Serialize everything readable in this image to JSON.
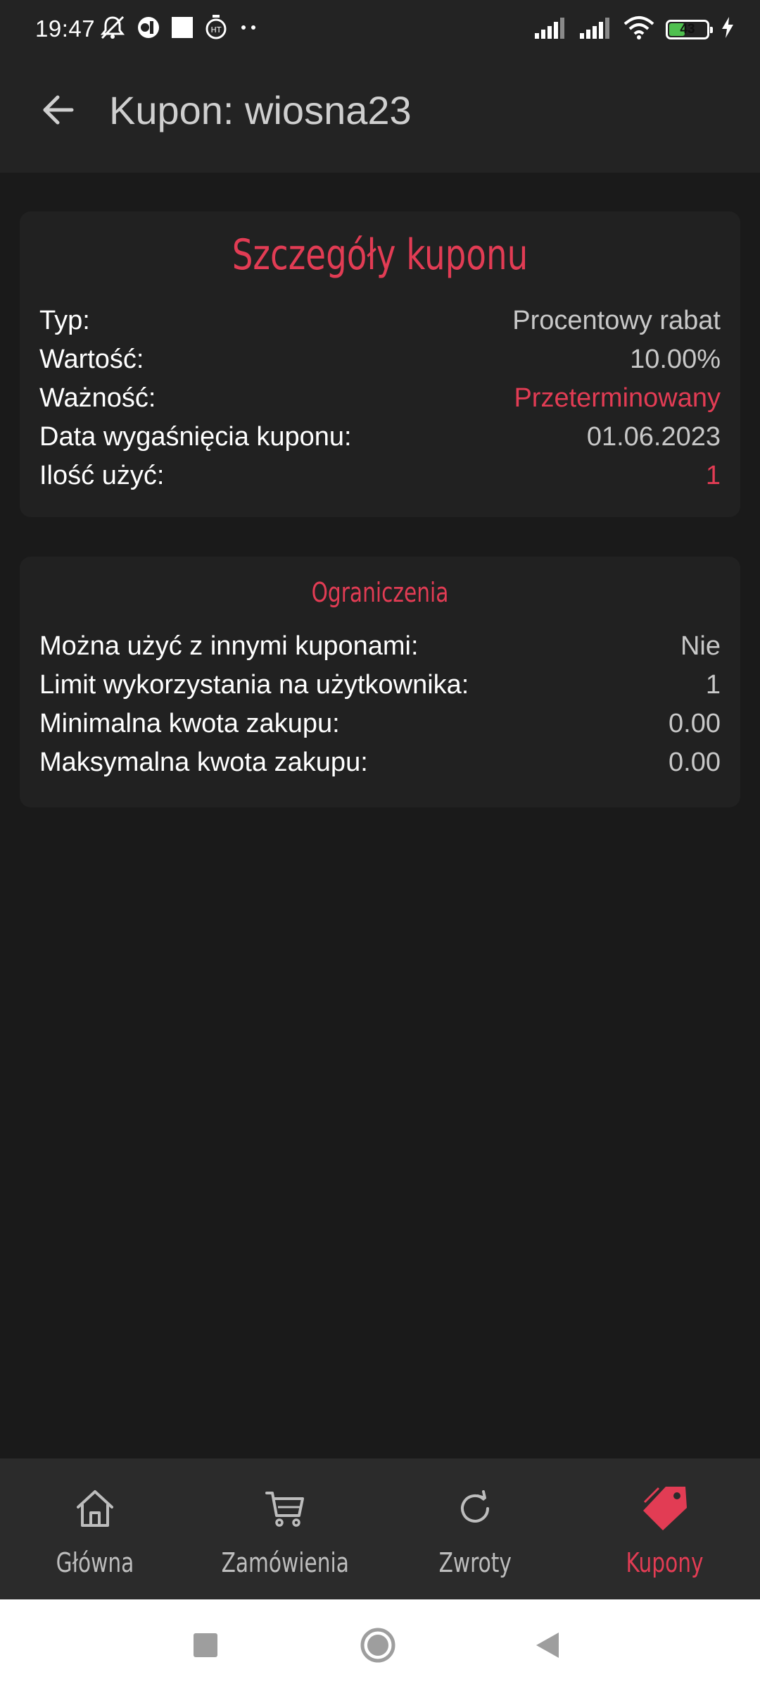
{
  "status_bar": {
    "time": "19:47",
    "battery_level": "43",
    "left_icons": [
      "mute-icon",
      "circle-app-icon",
      "square-app-icon",
      "timer-icon",
      "more-dots-icon"
    ],
    "right_icons": [
      "signal-icon",
      "signal-icon",
      "wifi-icon",
      "battery-icon",
      "charging-icon"
    ]
  },
  "app_bar": {
    "title": "Kupon: wiosna23",
    "back_icon": "arrow-left-icon"
  },
  "details_card": {
    "title": "Szczegóły kuponu",
    "rows": [
      {
        "label": "Typ:",
        "value": "Procentowy rabat"
      },
      {
        "label": "Wartość:",
        "value": "10.00%"
      },
      {
        "label": "Ważność:",
        "value": "Przeterminowany"
      },
      {
        "label": "Data wygaśnięcia kuponu:",
        "value": "01.06.2023"
      },
      {
        "label": "Ilość użyć:",
        "value": "1"
      }
    ]
  },
  "limits_card": {
    "title": "Ograniczenia",
    "rows": [
      {
        "label": "Można użyć z innymi kuponami:",
        "value": "Nie"
      },
      {
        "label": "Limit wykorzystania na użytkownika:",
        "value": "1"
      },
      {
        "label": "Minimalna kwota zakupu:",
        "value": "0.00"
      },
      {
        "label": "Maksymalna kwota zakupu:",
        "value": "0.00"
      }
    ]
  },
  "bottom_nav": {
    "items": [
      {
        "label": "Główna",
        "icon": "home-icon",
        "active": false
      },
      {
        "label": "Zamówienia",
        "icon": "cart-icon",
        "active": false
      },
      {
        "label": "Zwroty",
        "icon": "refresh-icon",
        "active": false
      },
      {
        "label": "Kupony",
        "icon": "tag-icon",
        "active": true
      }
    ]
  },
  "system_nav": {
    "buttons": [
      "recents-square-icon",
      "home-circle-icon",
      "back-triangle-icon"
    ]
  },
  "colors": {
    "accent": "#e23c54",
    "background": "#1a1a1a",
    "card": "#212121",
    "top_bar": "#232323",
    "bottom_nav": "#2b2b2b"
  }
}
